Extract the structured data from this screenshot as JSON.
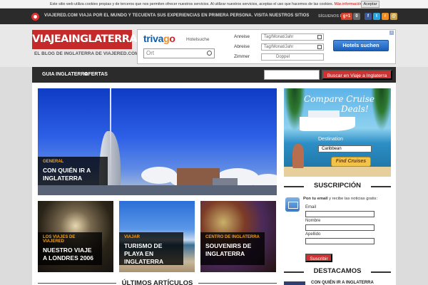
{
  "cookie_bar": {
    "text": "Este sitio web utiliza cookies propias y de terceros que nos permiten ofrecer nuestros servicios. Al utilizar nuestros servicios, aceptas el uso que hacemos de las cookies.",
    "link": "Más información",
    "accept": "Aceptar"
  },
  "topbar": {
    "tagline": "VIAJERED.COM VIAJA POR EL MUNDO Y TECUENTA SUS EXPERIENCIAS EN PRIMERA PERSONA. VISITA NUESTROS SITIOS",
    "follow": "SÍGUENOS EN",
    "social": [
      {
        "icon": "google-plus-icon",
        "label": "g+1",
        "color": "#d3422d"
      },
      {
        "icon": "counter-badge",
        "label": "0",
        "color": "#6b6b6b"
      },
      {
        "icon": "facebook-icon",
        "label": "f",
        "color": "#3b5998"
      },
      {
        "icon": "twitter-icon",
        "label": "t",
        "color": "#2aa3e0"
      },
      {
        "icon": "rss-icon",
        "label": "r",
        "color": "#f28c20"
      },
      {
        "icon": "email-icon",
        "label": "@",
        "color": "#c8a040"
      }
    ]
  },
  "header": {
    "brand": "VIAJEAINGLATERRA",
    "subtitle": "EL BLOG DE INGLATERRA DE VIAJERED.COM"
  },
  "trivago": {
    "logo_parts": [
      "tri",
      "v",
      "a",
      "g",
      "o"
    ],
    "subtitle": "Hotelsuche",
    "search_placeholder": "Ort",
    "anreise_label": "Anreise",
    "anreise_value": "Tag/Monat/Jahr",
    "abreise_label": "Abreise",
    "abreise_value": "Tag/Monat/Jahr",
    "zimmer_label": "Zimmer",
    "zimmer_value": "Doppel",
    "button": "Hotels suchen",
    "info": "i"
  },
  "nav": {
    "items": [
      "GUIA INGLATERRA",
      "OFERTAS"
    ],
    "search_button": "Buscar en Viaje a Inglaterra"
  },
  "hero": {
    "category": "GENERAL",
    "title": "CON QUIÉN IR A INGLATERRA"
  },
  "thumbs": [
    {
      "category": "LOS VIAJES DE VIAJERED",
      "title": "NUESTRO VIAJE A LONDRES 2006"
    },
    {
      "category": "VIAJAR",
      "title": "TURISMO DE PLAYA EN INGLATERRA"
    },
    {
      "category": "CENTRO DE INGLATERRA",
      "title": "SOUVENIRS DE INGLATERRA"
    }
  ],
  "latest_heading": "ÚLTIMOS ARTÍCULOS",
  "ad": {
    "title_line1": "Compare Cruise",
    "title_line2": "Deals!",
    "destination_label": "Destination",
    "destination_value": "Caribbean",
    "button": "Find Cruises"
  },
  "subscription": {
    "heading": "SUSCRIPCIÓN",
    "text_bold": "Pon tu email",
    "text_rest": " y recibe las noticias gratis:",
    "email_label": "Email",
    "name_label": "Nombre",
    "surname_label": "Apellido",
    "button": "Suscribir"
  },
  "featured": {
    "heading": "DESTACAMOS",
    "item": "CON QUIÉN IR A INGLATERRA"
  }
}
